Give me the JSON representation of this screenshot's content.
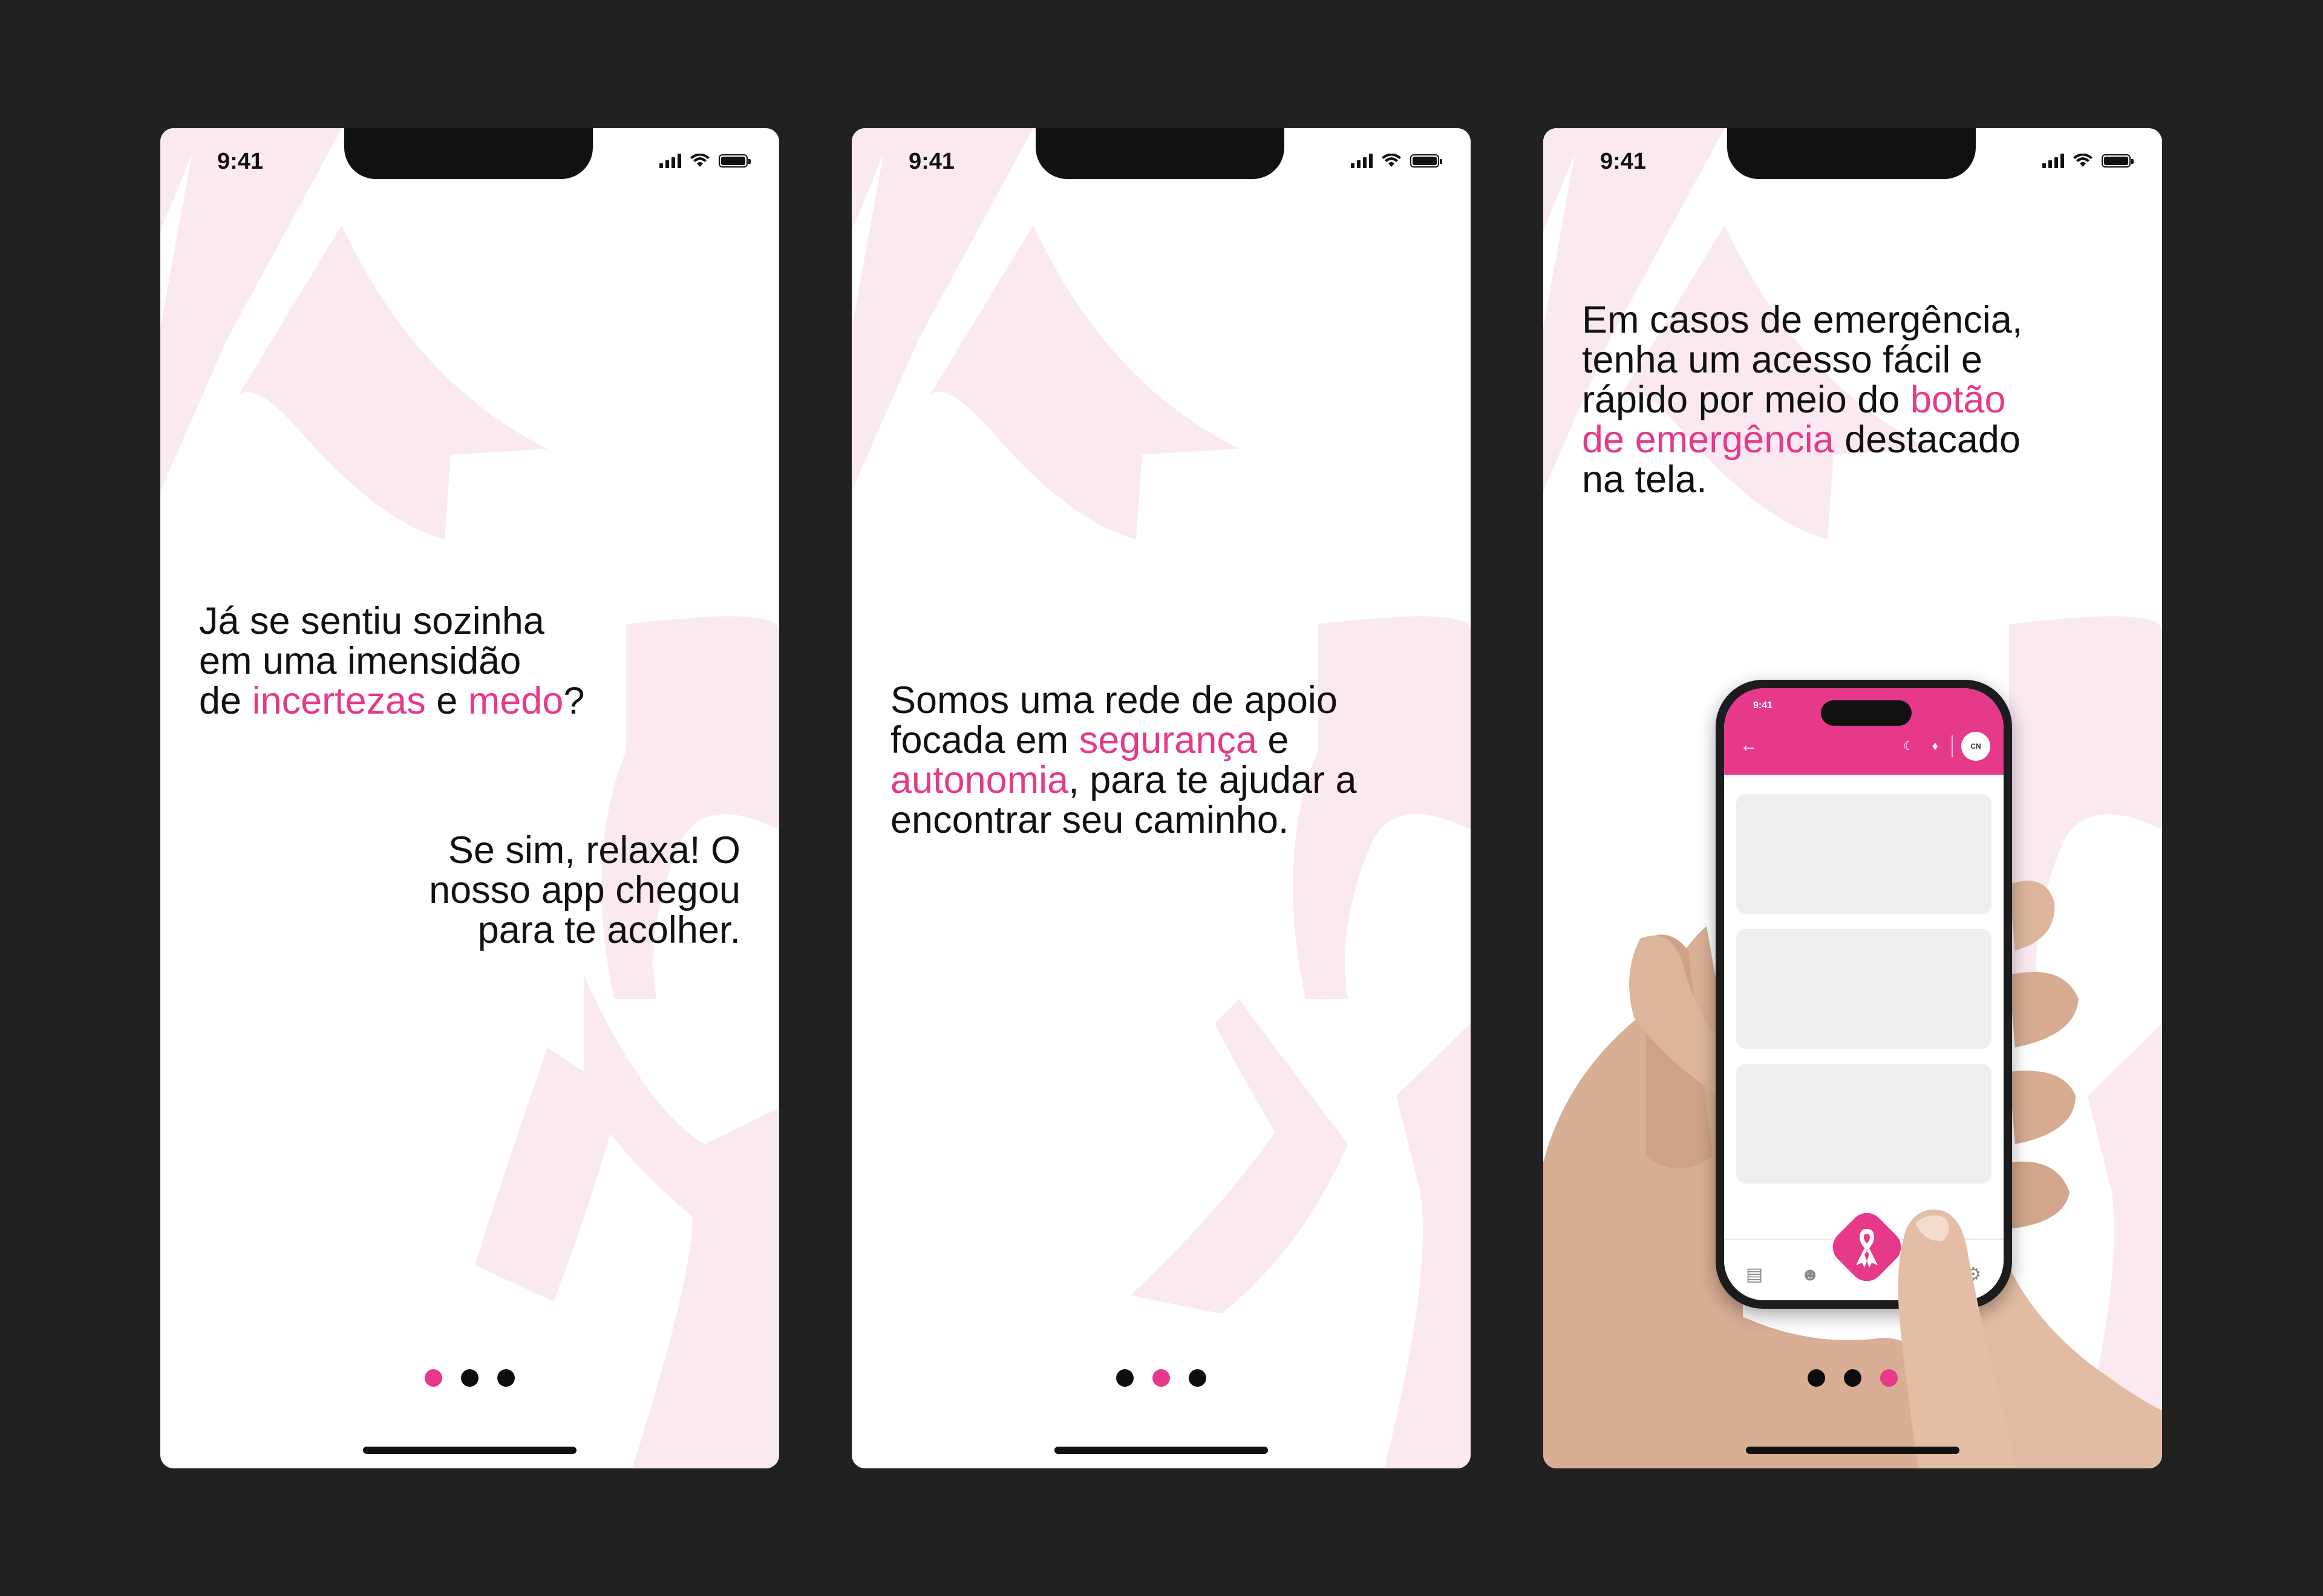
{
  "colors": {
    "accent": "#e6398a",
    "canvas": "#212121",
    "ribbon_tint": "#fbe9f2",
    "text": "#111111"
  },
  "status_bar": {
    "time": "9:41",
    "icons": [
      "signal-icon",
      "wifi-icon",
      "battery-icon"
    ]
  },
  "screens": [
    {
      "paragraphs": [
        {
          "pre1": "Já se sentiu sozinha",
          "pre2": "em uma imensidão",
          "pre3": "de ",
          "hl1": "incertezas",
          "mid": " e ",
          "hl2": "medo",
          "post": "?"
        },
        {
          "l1": "Se sim, relaxa! O",
          "l2": "nosso app chegou",
          "l3": "para te acolher."
        }
      ],
      "pagination": {
        "active_index": 0,
        "count": 3
      }
    },
    {
      "paragraphs": [
        {
          "l1": "Somos uma rede de apoio",
          "l2a": "focada em ",
          "hl1": "segurança",
          "l2b": " e",
          "hl2": "autonomia",
          "l3b": ", para te ajudar a",
          "l4": "encontrar seu caminho."
        }
      ],
      "pagination": {
        "active_index": 1,
        "count": 3
      }
    },
    {
      "paragraphs": [
        {
          "l1": "Em casos de emergência,",
          "l2": "tenha um acesso fácil e",
          "l3a": "rápido por meio do ",
          "hl1": "botão",
          "hl2": "de emergência",
          "l4b": " destacado",
          "l5": "na tela."
        }
      ],
      "mock_phone": {
        "time": "9:41",
        "avatar_initials": "CN",
        "header_icons": [
          "back-arrow-icon",
          "moon-icon",
          "bell-icon"
        ],
        "tab_icons": [
          "news-icon",
          "community-icon",
          "emergency-ribbon-icon",
          "settings-icon"
        ]
      },
      "pagination": {
        "active_index": 2,
        "count": 3
      }
    }
  ]
}
